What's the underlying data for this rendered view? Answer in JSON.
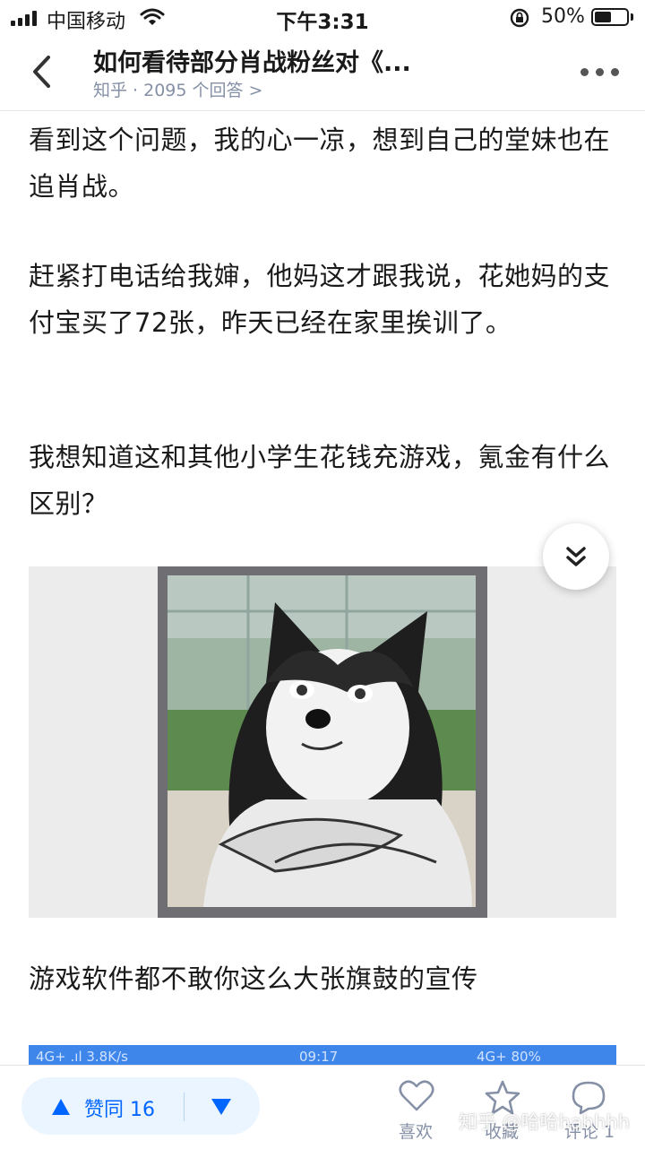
{
  "status_bar": {
    "carrier": "中国移动",
    "time": "下午3:31",
    "battery_pct": "50%"
  },
  "header": {
    "title": "如何看待部分肖战粉丝对《...",
    "subtitle": "知乎 · 2095 个回答 >"
  },
  "content": {
    "paragraphs": [
      "看到这个问题，我的心一凉，想到自己的堂妹也在追肖战。",
      "赶紧打电话给我婶，他妈这才跟我说，花她妈的支付宝买了72张，昨天已经在家里挨训了。",
      "我想知道这和其他小学生花钱充游戏，氪金有什么区别？",
      "游戏软件都不敢你这么大张旗鼓的宣传"
    ],
    "image_icon": "husky-meme",
    "second_screenshot": {
      "left": "4G+ .ıl 3.8K/s",
      "center": "09:17",
      "right": "4G+ 80%"
    }
  },
  "bottom_bar": {
    "vote_label": "赞同 16",
    "actions": [
      {
        "label": "喜欢",
        "icon": "heart-icon"
      },
      {
        "label": "收藏",
        "icon": "star-icon"
      },
      {
        "label": "评论 1",
        "icon": "comment-icon"
      }
    ],
    "watermark": "知乎 @哈哈hahhhh"
  },
  "colors": {
    "accent": "#0066ff",
    "vote_bg": "#ebf5ff",
    "muted": "#8590a6"
  }
}
